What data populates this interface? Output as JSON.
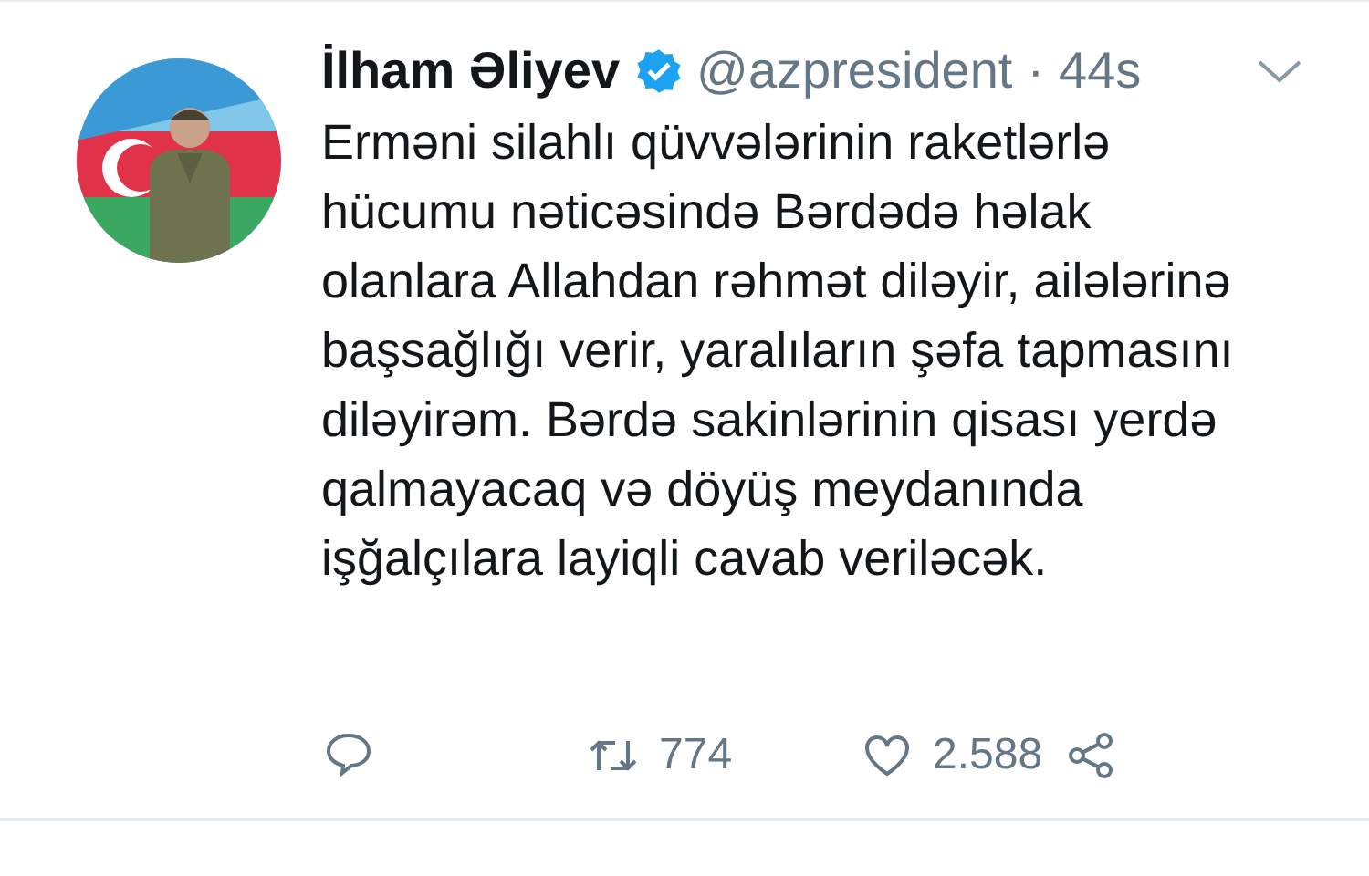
{
  "tweet": {
    "name": "İlham Əliyev",
    "verified": true,
    "handle": "@azpresident",
    "separator": "·",
    "time": "44s",
    "text": "Erməni silahlı qüvvələrinin raketlərlə hücumu nəticəsində Bərdədə həlak olanlara Allahdan rəhmət diləyir, ailələrinə başsağlığı verir, yaralıların şəfa tapmasını diləyirəm. Bərdə sakinlərinin qisası yerdə qalmayacaq və döyüş meydanında işğalçılara layiqli cavab veriləcək.",
    "actions": [
      {
        "kind": "reply"
      },
      {
        "kind": "retweet",
        "count": "774"
      },
      {
        "kind": "like",
        "count": "2.588"
      },
      {
        "kind": "share"
      }
    ]
  }
}
